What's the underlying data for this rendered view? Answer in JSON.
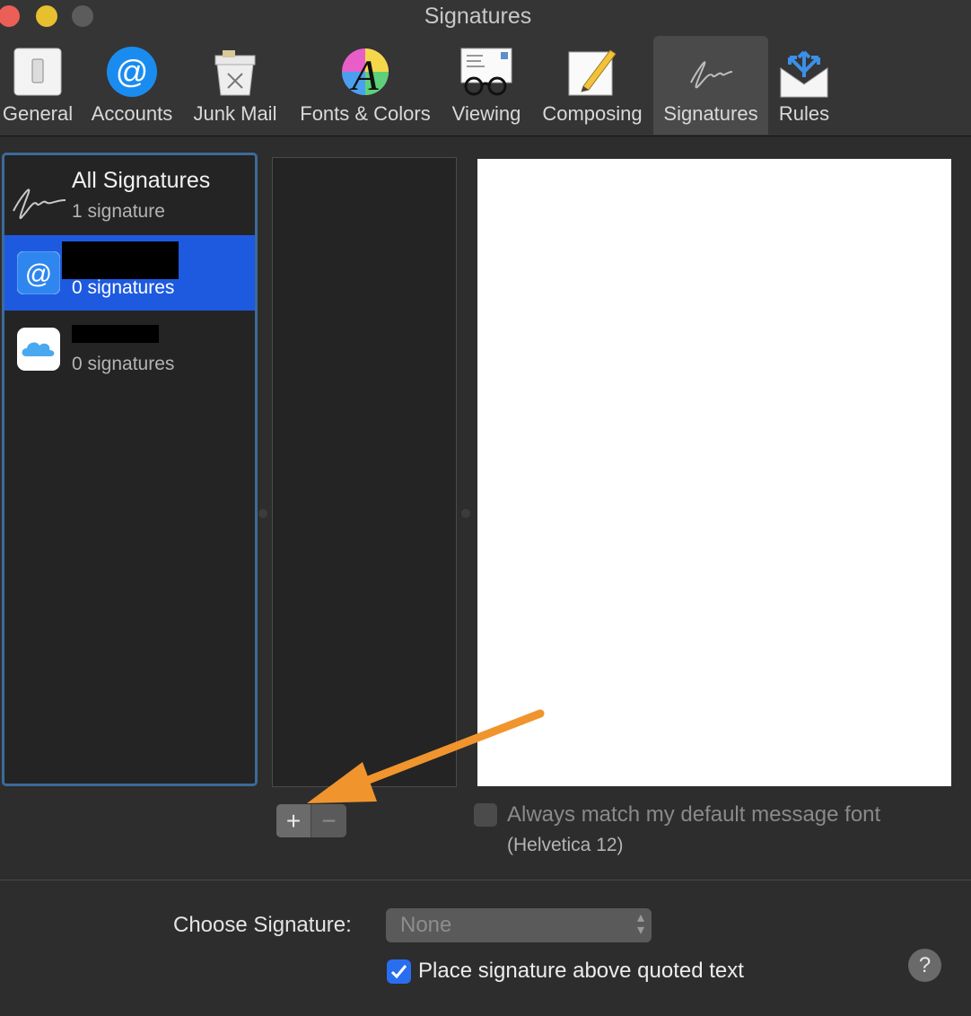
{
  "window": {
    "title": "Signatures"
  },
  "toolbar": {
    "items": [
      {
        "label": "General"
      },
      {
        "label": "Accounts"
      },
      {
        "label": "Junk Mail"
      },
      {
        "label": "Fonts & Colors"
      },
      {
        "label": "Viewing"
      },
      {
        "label": "Composing"
      },
      {
        "label": "Signatures"
      },
      {
        "label": "Rules"
      }
    ],
    "active": "Signatures"
  },
  "accounts": {
    "rows": [
      {
        "title": "All Signatures",
        "subtitle": "1 signature",
        "icon": "signature-icon"
      },
      {
        "title": "",
        "subtitle": "0 signatures",
        "icon": "at-icon",
        "selected": true
      },
      {
        "title": "",
        "subtitle": "0 signatures",
        "icon": "icloud-icon"
      }
    ]
  },
  "buttons": {
    "add": "+",
    "remove": "−"
  },
  "font_option": {
    "label": "Always match my default message font",
    "sub": "(Helvetica 12)",
    "checked": false
  },
  "choose": {
    "label": "Choose Signature:",
    "value": "None"
  },
  "place": {
    "label": "Place signature above quoted text",
    "checked": true
  },
  "help": {
    "label": "?"
  },
  "colors": {
    "selection": "#1e5ae0",
    "arrow": "#f0952d",
    "checkbox": "#2a6ef0"
  }
}
